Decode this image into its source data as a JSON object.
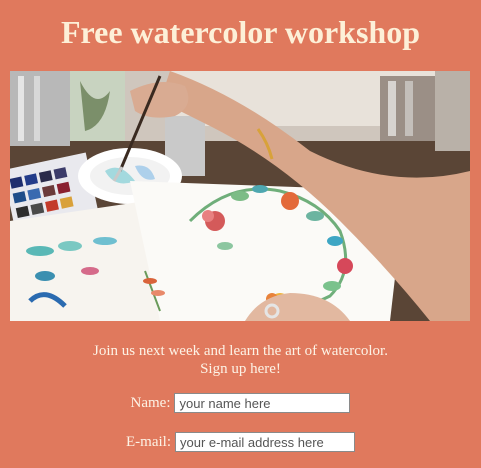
{
  "page": {
    "title": "Free watercolor workshop",
    "background_color": "#e0795d"
  },
  "hero_image": {
    "description_icon": "watercolor-painting-photo"
  },
  "intro": {
    "line1": "Join us next week and learn the art of watercolor.",
    "line2": "Sign up here!"
  },
  "form": {
    "name_label": "Name:",
    "name_placeholder": "your name here",
    "email_label": "E-mail:",
    "email_placeholder": "your e-mail address here"
  }
}
